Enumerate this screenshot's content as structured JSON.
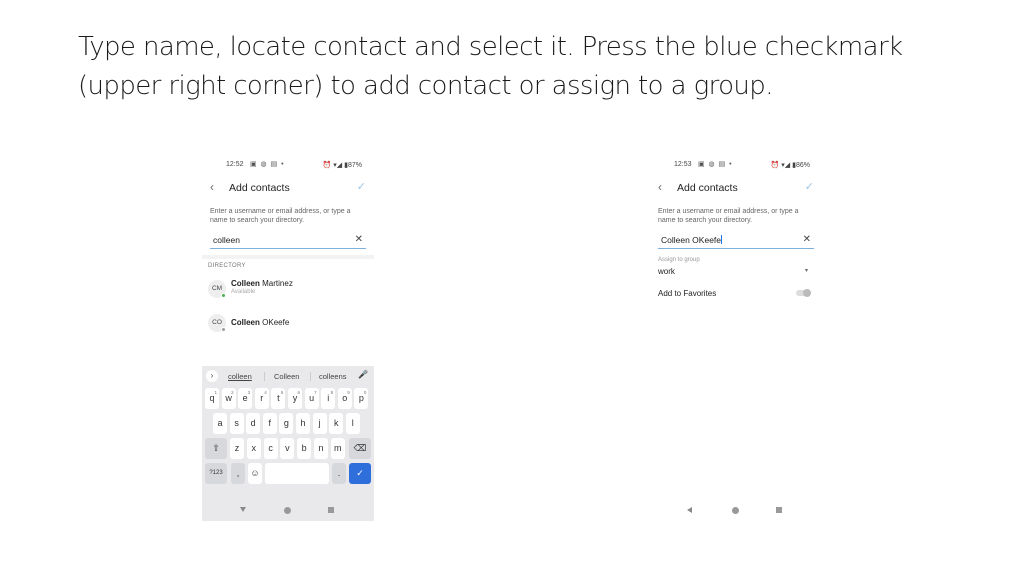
{
  "slide": {
    "instruction": "Type name, locate contact and select it.  Press the blue checkmark (upper right corner) to add contact or assign to a group."
  },
  "left_phone": {
    "status": {
      "time": "12:52",
      "app_icons": "▣ ◍ ▤ •",
      "right": "⏰ ▾◢ ▮87%"
    },
    "appbar": {
      "back_icon": "‹",
      "title": "Add contacts",
      "check_icon": "✓"
    },
    "hint": "Enter a username or email address, or type a name to search your directory.",
    "search": {
      "value": "colleen",
      "clear_icon": "✕"
    },
    "directory_label": "DIRECTORY",
    "contacts": [
      {
        "initials": "CM",
        "first": "Colleen",
        "last": "Martinez",
        "status": "Available",
        "presence_color": "#4caf50"
      },
      {
        "initials": "CO",
        "first": "Colleen",
        "last": "OKeefe",
        "status": "",
        "presence_color": "#9e9e9e"
      }
    ],
    "keyboard": {
      "expand_icon": "›",
      "suggestions": [
        "colleen",
        "Colleen",
        "colleens"
      ],
      "mic_icon": "🎤",
      "row1": [
        "q",
        "w",
        "e",
        "r",
        "t",
        "y",
        "u",
        "i",
        "o",
        "p"
      ],
      "row1_nums": [
        "1",
        "2",
        "3",
        "4",
        "5",
        "6",
        "7",
        "8",
        "9",
        "0"
      ],
      "row2": [
        "a",
        "s",
        "d",
        "f",
        "g",
        "h",
        "j",
        "k",
        "l"
      ],
      "row3": [
        "z",
        "x",
        "c",
        "v",
        "b",
        "n",
        "m"
      ],
      "shift_icon": "⇧",
      "backspace_icon": "⌫",
      "symbols_label": "?123",
      "comma": ",",
      "emoji_icon": "☺",
      "period": ".",
      "enter_icon": "✓"
    }
  },
  "right_phone": {
    "status": {
      "time": "12:53",
      "app_icons": "▣ ◍ ▤ •",
      "right": "⏰ ▾◢ ▮86%"
    },
    "appbar": {
      "back_icon": "‹",
      "title": "Add contacts",
      "check_icon": "✓"
    },
    "hint": "Enter a username or email address, or type a name to search your directory.",
    "search": {
      "value": "Colleen OKeefe",
      "clear_icon": "✕"
    },
    "group_label": "Assign to group",
    "group_value": "work",
    "dropdown_icon": "▾",
    "favorites_label": "Add to Favorites",
    "favorites_on": false
  }
}
